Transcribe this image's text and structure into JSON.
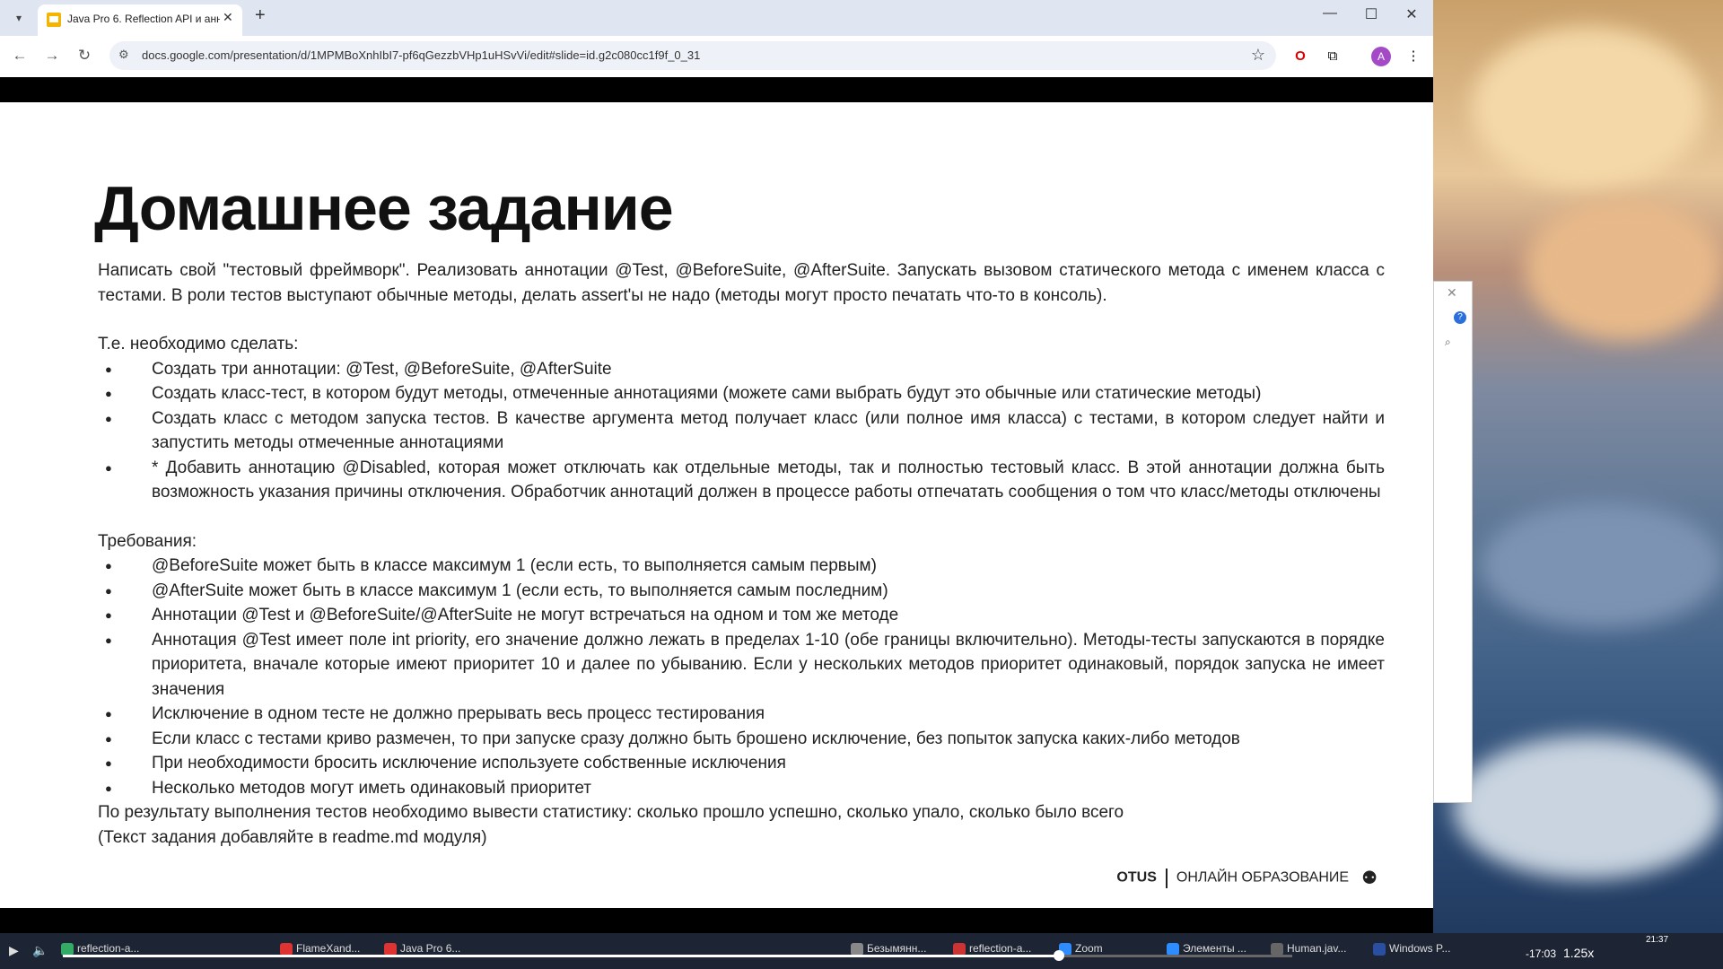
{
  "browser": {
    "tab_title": "Java Pro 6. Reflection API и анн",
    "url": "docs.google.com/presentation/d/1MPMBoXnhIbI7-pf6qGezzbVHp1uHSvVi/edit#slide=id.g2c080cc1f9f_0_31",
    "avatar_letter": "A"
  },
  "slide": {
    "title": "Домашнее задание",
    "intro": "Написать свой \"тестовый фреймворк\". Реализовать аннотации @Test, @BeforeSuite, @AfterSuite. Запускать вызовом статического метода с именем класса с тестами. В роли тестов выступают обычные методы, делать assert'ы не надо (методы могут просто печатать что-то в консоль).",
    "todo_label": "Т.е. необходимо сделать:",
    "todo_items": [
      "Создать три аннотации: @Test, @BeforeSuite, @AfterSuite",
      "Создать класс-тест, в котором будут методы, отмеченные аннотациями (можете сами выбрать будут это обычные или статические методы)",
      "Создать класс с методом запуска тестов. В качестве аргумента метод получает класс (или полное имя класса) с тестами, в котором следует найти и запустить методы отмеченные аннотациями",
      "* Добавить аннотацию @Disabled, которая может отключать как отдельные методы, так и полностью тестовый класс. В этой аннотации должна быть возможность указания причины отключения. Обработчик аннотаций должен в процессе работы отпечатать сообщения о том что класс/методы отключены"
    ],
    "req_label": "Требования:",
    "req_items": [
      "@BeforeSuite может быть в классе максимум 1 (если есть, то выполняется самым первым)",
      "@AfterSuite может быть в классе максимум 1 (если есть, то выполняется самым последним)",
      "Аннотации @Test и @BeforeSuite/@AfterSuite не могут встречаться на одном и том же методе",
      "Аннотация @Test имеет поле int priority, его значение должно лежать в пределах 1-10 (обе границы включительно). Методы-тесты запускаются в порядке приоритета, вначале которые имеют приоритет 10 и далее по убыванию. Если у нескольких методов приоритет одинаковый, порядок запуска не имеет значения",
      "Исключение в одном тесте не должно прерывать весь процесс тестирования",
      "Если класс с тестами криво размечен, то при запуске сразу должно быть брошено исключение, без попыток запуска каких-либо методов",
      "При необходимости бросить исключение используете собственные исключения",
      "Несколько методов могут иметь одинаковый приоритет"
    ],
    "outro1": "По результату выполнения тестов необходимо вывести статистику: сколько прошло успешно, сколько упало, сколько было всего",
    "outro2": "(Текст задания добавляйте в readme.md модуля)",
    "brand": "OTUS",
    "brand_tagline": "ОНЛАЙН ОБРАЗОВАНИЕ"
  },
  "taskbar": {
    "items": [
      "reflection-a...",
      "FlameXand...",
      "Java Pro 6...",
      "Безымянн...",
      "reflection-a...",
      "Zoom",
      "Элементы ...",
      "Human.jav...",
      "Windows P..."
    ],
    "time": "21:37",
    "player_time": "-17:03",
    "speed": "1.25x",
    "progress": 0.81
  }
}
